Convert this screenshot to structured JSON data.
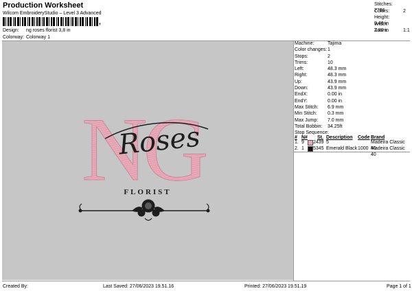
{
  "header": {
    "title": "Production Worksheet",
    "subtitle": "Wilcom EmbroideryStudio – Level 3 Advanced",
    "barcode_suffix": ","
  },
  "fields": {
    "design_label": "Design:",
    "design_value": "ng roses florist 3,8 in",
    "colorway_label": "Colorway:",
    "colorway_value": "Colorway 1"
  },
  "stats": [
    {
      "label": "Stitches:",
      "value": "7786"
    },
    {
      "label": "Colors:",
      "value": "2"
    },
    {
      "label": "Height:",
      "value": "3.46 in"
    },
    {
      "label": "Width:",
      "value": "3.80 in"
    },
    {
      "label": "Zoom:",
      "value": "1:1"
    }
  ],
  "design": {
    "big_letters": "NG",
    "script_word": "Roses",
    "florist_word": "FLORIST"
  },
  "colors": {
    "pink": "#e8a9b8",
    "pink_dark": "#c97f93",
    "black": "#1e1e1e",
    "canvas": "#c6c6c6"
  },
  "info": [
    {
      "label": "Machine:",
      "value": "Tajima"
    },
    {
      "label": "Color changes:",
      "value": "1"
    },
    {
      "label": "Stops:",
      "value": "2"
    },
    {
      "label": "Trims:",
      "value": "10"
    },
    {
      "label": "Left:",
      "value": "48.3 mm"
    },
    {
      "label": "Right:",
      "value": "48.3 mm"
    },
    {
      "label": "Up:",
      "value": "43.9 mm"
    },
    {
      "label": "Down:",
      "value": "43.9 mm"
    },
    {
      "label": "EndX:",
      "value": "0.00 in"
    },
    {
      "label": "EndY:",
      "value": "0.00 in"
    },
    {
      "label": "Max Stitch:",
      "value": "6.9 mm"
    },
    {
      "label": "Min Stitch:",
      "value": "0.3 mm"
    },
    {
      "label": "Max Jump:",
      "value": "7.0 mm"
    },
    {
      "label": "Total Bobbin:",
      "value": "34.25ft"
    },
    {
      "label": "Stop Sequence:",
      "value": ""
    }
  ],
  "stop_table": {
    "headers": [
      "#",
      "N#",
      "St.",
      "Description",
      "Code",
      "Brand"
    ],
    "rows": [
      {
        "num": "1.",
        "n": "9",
        "color": "#e8a9b8",
        "st": "2439",
        "desc": "5",
        "code": "",
        "brand": "Madeira Classic 40"
      },
      {
        "num": "2.",
        "n": "1",
        "color": "#111111",
        "st": "5345",
        "desc": "Emerald Black",
        "code": "1000",
        "brand": "Madeira Classic 40"
      }
    ]
  },
  "footer": {
    "created_by": "Created By:",
    "last_saved": "Last Saved: 27/06/2023 19.51.16",
    "printed": "Printed: 27/06/2023 19.51.19",
    "page": "Page 1 of 1"
  }
}
